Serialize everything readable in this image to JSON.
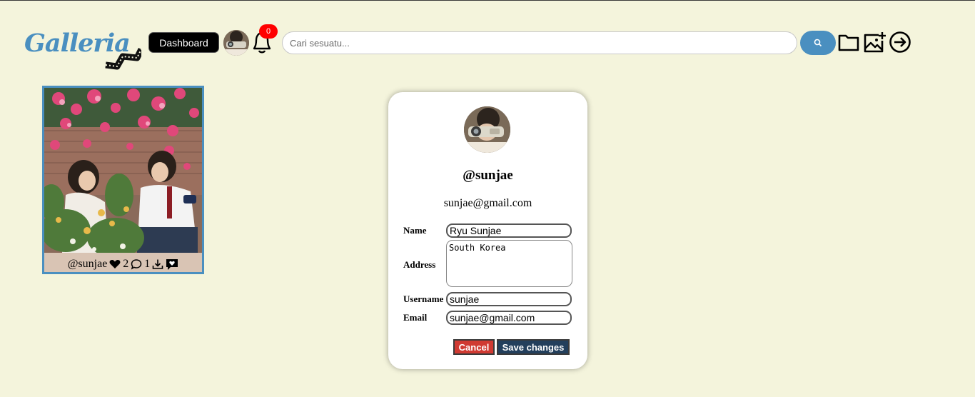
{
  "header": {
    "logo_text": "Galleria",
    "dashboard_label": "Dashboard",
    "notification_count": "0",
    "search_placeholder": "Cari sesuatu...",
    "icons": [
      "search-icon",
      "folder-icon",
      "add-image-icon",
      "logout-icon"
    ]
  },
  "gallery": {
    "items": [
      {
        "author": "@sunjae",
        "likes": "2",
        "comments": "1"
      }
    ]
  },
  "profile": {
    "username": "@sunjae",
    "email": "sunjae@gmail.com",
    "form": {
      "name_label": "Name",
      "name_value": "Ryu Sunjae",
      "address_label": "Address",
      "address_value": "South Korea",
      "username_label": "Username",
      "username_value": "sunjae",
      "email_label": "Email",
      "email_value": "sunjae@gmail.com"
    },
    "cancel_label": "Cancel",
    "save_label": "Save changes"
  },
  "colors": {
    "background": "#f4f4dc",
    "accent": "#4a8fc0",
    "cancel": "#d03a32",
    "save": "#233f5c",
    "badge": "#ff0000"
  }
}
